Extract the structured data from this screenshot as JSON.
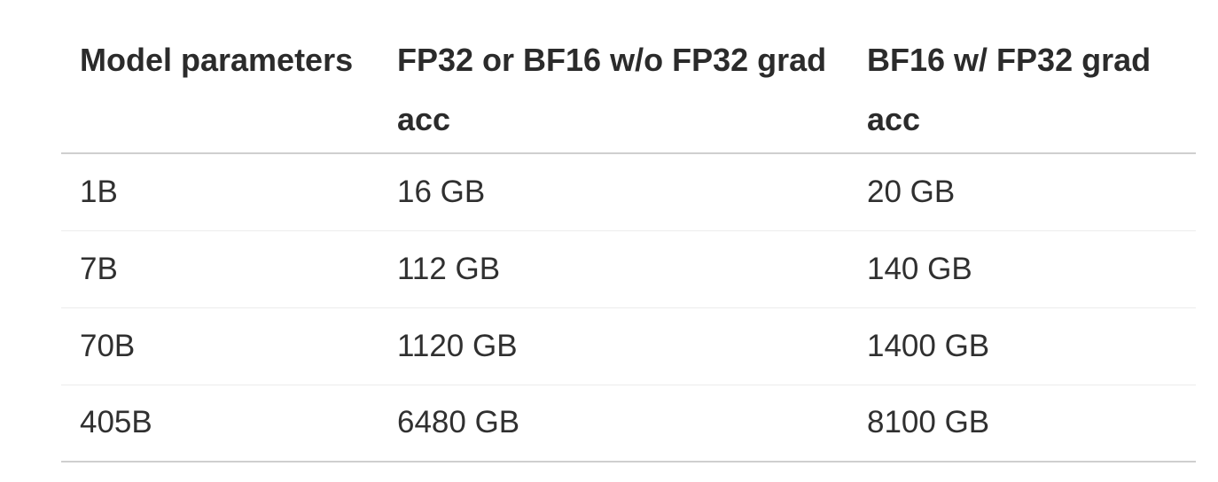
{
  "table": {
    "headers": [
      "Model parameters",
      "FP32 or BF16 w/o FP32 grad acc",
      "BF16 w/ FP32 grad acc"
    ],
    "rows": [
      [
        "1B",
        "16 GB",
        "20 GB"
      ],
      [
        "7B",
        "112 GB",
        "140 GB"
      ],
      [
        "70B",
        "1120 GB",
        "1400 GB"
      ],
      [
        "405B",
        "6480 GB",
        "8100 GB"
      ]
    ]
  }
}
